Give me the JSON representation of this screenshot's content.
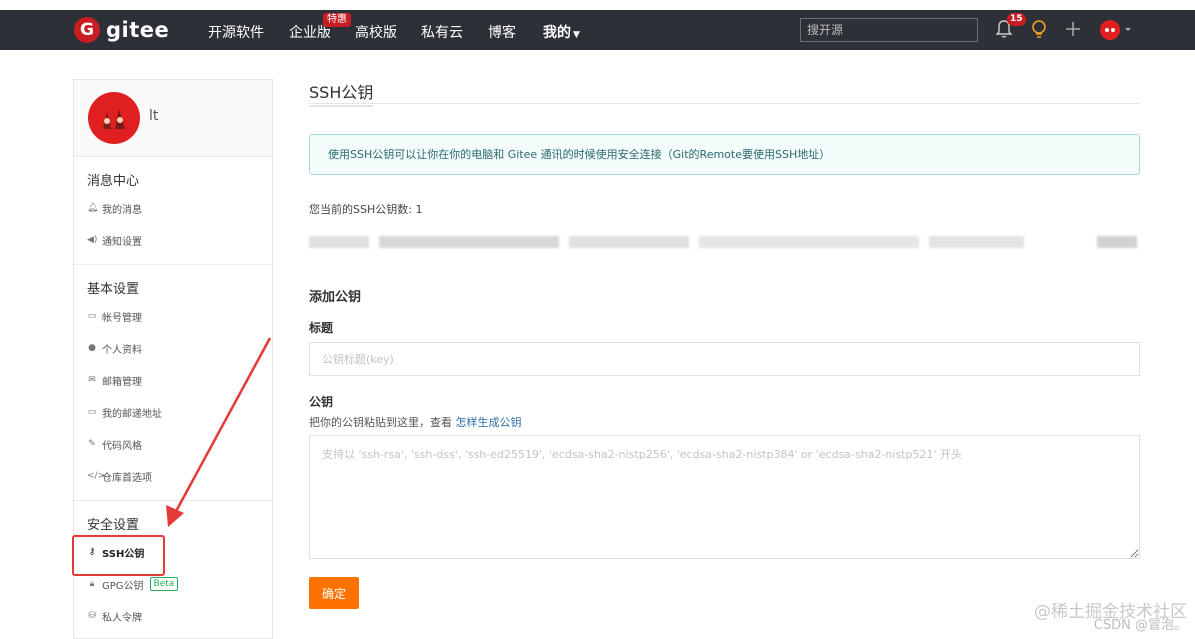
{
  "topnav": {
    "logo_letter": "G",
    "logo_text": "gitee",
    "items": [
      "开源软件",
      "企业版",
      "高校版",
      "私有云",
      "博客",
      "我的"
    ],
    "special_badge": "特惠",
    "search_placeholder": "搜开源",
    "notification_count": "15",
    "brand_color": "#c71d23",
    "bar_color": "#2d3037"
  },
  "sidebar": {
    "username": "lt",
    "sections": [
      {
        "title": "消息中心",
        "items": [
          {
            "icon": "bell-icon",
            "label": "我的消息"
          },
          {
            "icon": "speaker-icon",
            "label": "通知设置"
          }
        ]
      },
      {
        "title": "基本设置",
        "items": [
          {
            "icon": "id-card-icon",
            "label": "帐号管理"
          },
          {
            "icon": "user-icon",
            "label": "个人资料"
          },
          {
            "icon": "mail-icon",
            "label": "邮箱管理"
          },
          {
            "icon": "address-card-icon",
            "label": "我的邮递地址"
          },
          {
            "icon": "paint-brush-icon",
            "label": "代码风格"
          },
          {
            "icon": "code-icon",
            "label": "仓库首选项"
          }
        ]
      },
      {
        "title": "安全设置",
        "items": [
          {
            "icon": "key-icon",
            "label": "SSH公钥"
          },
          {
            "icon": "lock-icon",
            "label": "GPG公钥",
            "badge": "Beta"
          },
          {
            "icon": "token-icon",
            "label": "私人令牌"
          }
        ]
      }
    ]
  },
  "main": {
    "title": "SSH公钥",
    "info": "使用SSH公钥可以让你在你的电脑和 Gitee 通讯的时候使用安全连接（Git的Remote要使用SSH地址）",
    "key_count_text": "您当前的SSH公钥数: 1",
    "add_title": "添加公钥",
    "title_label": "标题",
    "title_placeholder": "公钥标题(key)",
    "key_label": "公钥",
    "key_hint": "把你的公钥粘贴到这里，查看",
    "key_hint_link": "怎样生成公钥",
    "key_placeholder": "支持以 'ssh-rsa', 'ssh-dss', 'ssh-ed25519', 'ecdsa-sha2-nistp256', 'ecdsa-sha2-nistp384' or 'ecdsa-sha2-nistp521' 开头",
    "submit_label": "确定",
    "accent_color": "#fe7300"
  },
  "watermark": {
    "line1": "@稀土掘金技术社区",
    "line2": "CSDN @冒泡。"
  }
}
